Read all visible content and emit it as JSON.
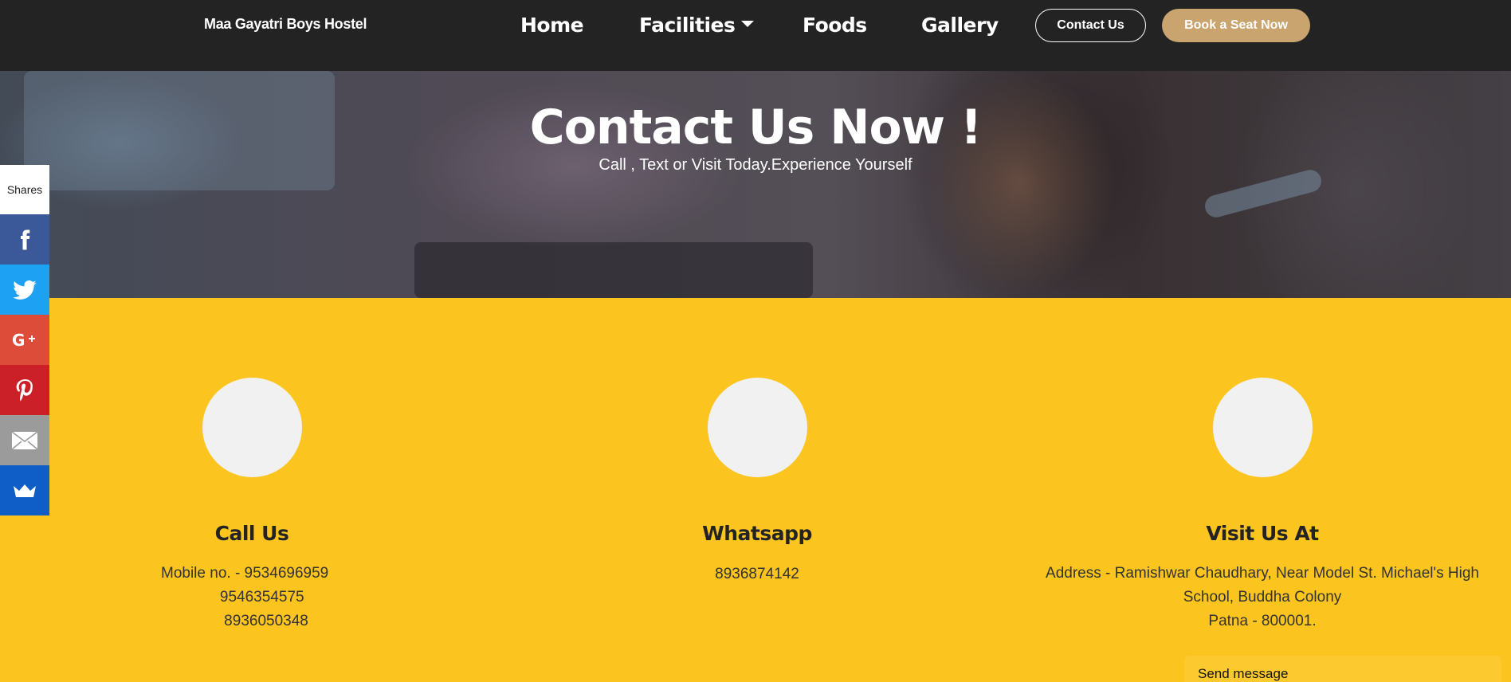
{
  "header": {
    "brand": "Maa Gayatri Boys Hostel",
    "nav": [
      {
        "label": "Home"
      },
      {
        "label": "Facilities"
      },
      {
        "label": "Foods"
      },
      {
        "label": "Gallery"
      }
    ],
    "contact_button": "Contact Us",
    "book_button": "Book a Seat Now"
  },
  "hero": {
    "title": "Contact Us Now !",
    "subtitle": "Call , Text or Visit Today.Experience Yourself"
  },
  "social": {
    "shares_label": "Shares",
    "buttons": [
      "facebook-icon",
      "twitter-icon",
      "google-plus-icon",
      "pinterest-icon",
      "email-icon",
      "sumome-crown-icon"
    ]
  },
  "contact": {
    "call": {
      "title": "Call Us",
      "lines": [
        "Mobile no. - 9534696959",
        "              9546354575",
        "               8936050348"
      ]
    },
    "whatsapp": {
      "title": "Whatsapp",
      "number": "8936874142"
    },
    "visit": {
      "title": "Visit Us At",
      "address_line1": "Address - Ramishwar Chaudhary, Near Model St. Michael's High",
      "address_line2": "School, Buddha Colony",
      "address_line3": "Patna - 800001."
    }
  },
  "chat": {
    "send_message": "Send message"
  },
  "colors": {
    "header_bg": "#232323",
    "accent_yellow": "#fbc41f",
    "book_button": "#c9a46f"
  }
}
